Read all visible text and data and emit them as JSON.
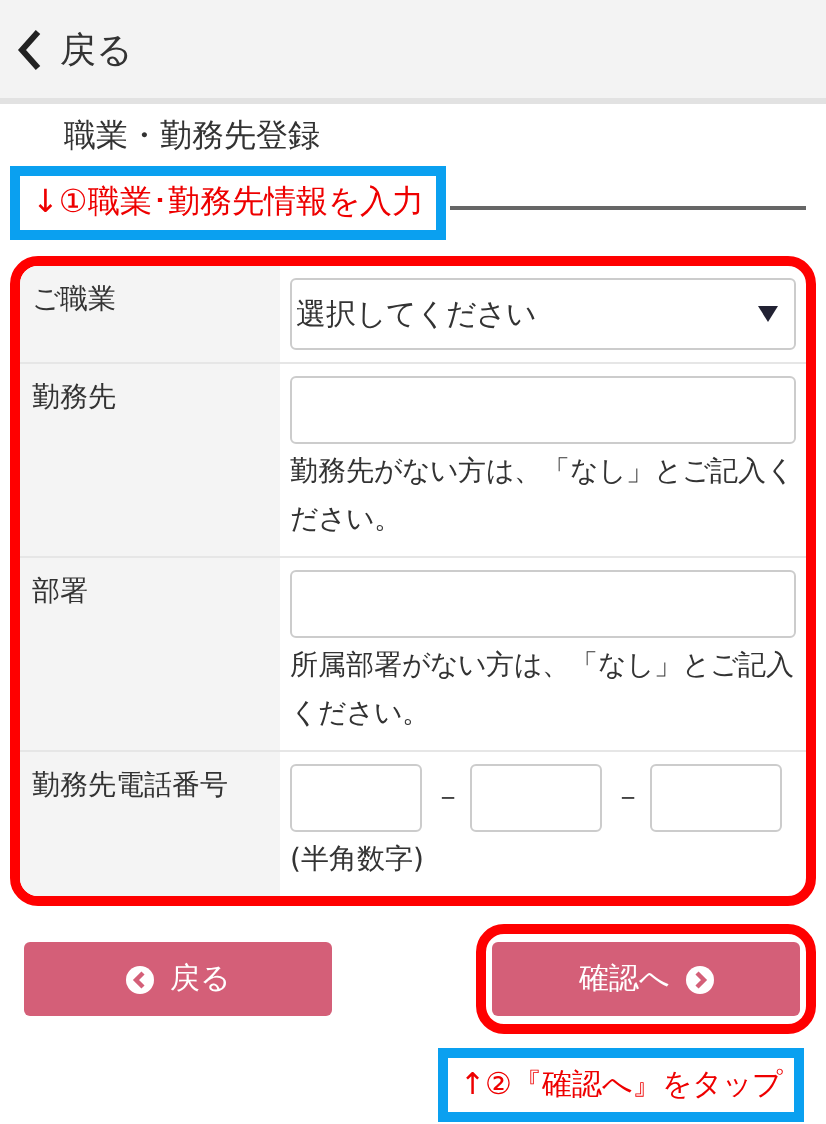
{
  "header": {
    "back_label": "戻る"
  },
  "heading": "職業・勤務先登録",
  "callouts": [
    {
      "text": "↓①職業･勤務先情報を入力"
    },
    {
      "text": "↑②『確認へ』をタップ"
    }
  ],
  "form": {
    "rows": [
      {
        "kind": "select",
        "label": "ご職業",
        "value": "選択してください"
      },
      {
        "kind": "text",
        "label": "勤務先",
        "note": "勤務先がない方は、「なし」とご記入ください。"
      },
      {
        "kind": "text",
        "label": "部署",
        "note": "所属部署がない方は、「なし」とご記入ください。"
      },
      {
        "kind": "phone",
        "label": "勤務先電話番号",
        "separators": [
          "－",
          "－"
        ],
        "note": "(半角数字)"
      }
    ]
  },
  "buttons": {
    "back": "戻る",
    "confirm": "確認へ"
  }
}
